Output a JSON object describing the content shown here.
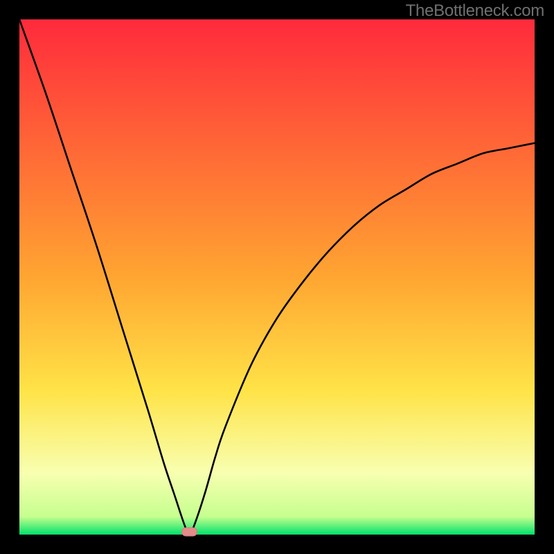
{
  "watermark": "TheBottleneck.com",
  "colors": {
    "frame": "#000000",
    "curve": "#000000",
    "green_band": "#00e26a",
    "red_top": "#ff2a3c",
    "yellow_mid": "#ffe347",
    "marker_fill": "#e48b8b",
    "marker_stroke": "#d77b7b"
  },
  "chart_data": {
    "type": "line",
    "title": "",
    "xlabel": "",
    "ylabel": "",
    "xlim": [
      0,
      100
    ],
    "ylim": [
      0,
      100
    ],
    "notes": "Bottleneck-style V-curve. Vertical axis ≈ bottleneck % (0 at bottom = balanced, 100 at top). Minimum occurs near x≈33, where the small pink marker sits on the baseline.",
    "vertex_x": 33,
    "series": [
      {
        "name": "bottleneck-curve",
        "x": [
          0,
          5,
          10,
          15,
          20,
          25,
          28,
          30,
          32,
          33,
          34,
          36,
          38,
          40,
          45,
          50,
          55,
          60,
          65,
          70,
          75,
          80,
          85,
          90,
          95,
          100
        ],
        "values": [
          100,
          86,
          71,
          56,
          40,
          24,
          14,
          8,
          2,
          0,
          2,
          8,
          15,
          21,
          33,
          42,
          49,
          55,
          60,
          64,
          67,
          70,
          72,
          74,
          75,
          76
        ]
      }
    ],
    "marker": {
      "x": 33,
      "y": 0,
      "shape": "rounded-rect"
    },
    "background": {
      "gradient_stops": [
        {
          "pos": 0.0,
          "color": "#ff2a3c"
        },
        {
          "pos": 0.5,
          "color": "#ffa531"
        },
        {
          "pos": 0.72,
          "color": "#ffe347"
        },
        {
          "pos": 0.88,
          "color": "#f8ffb0"
        },
        {
          "pos": 0.965,
          "color": "#c6ff8f"
        },
        {
          "pos": 1.0,
          "color": "#00e26a"
        }
      ]
    }
  }
}
